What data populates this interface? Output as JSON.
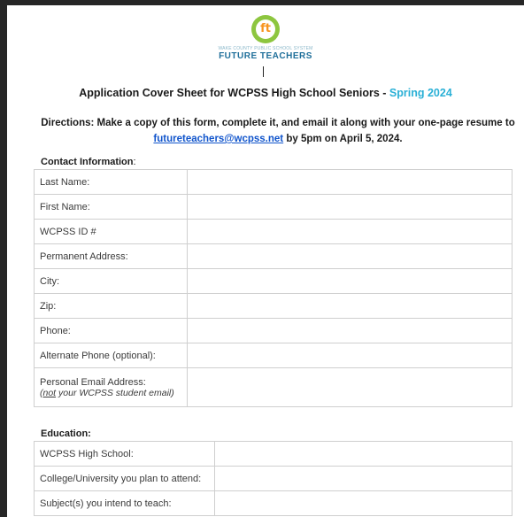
{
  "logo": {
    "mark": "ft",
    "subtitle": "WAKE COUNTY PUBLIC SCHOOL SYSTEM",
    "name": "FUTURE TEACHERS"
  },
  "title": {
    "main": "Application Cover Sheet for WCPSS High School Seniors - ",
    "accent": "Spring 2024"
  },
  "directions": {
    "line1": "Directions: Make a copy of this form, complete it, and email it along with your one-page resume to",
    "email": "futureteachers@wcpss.net",
    "line2_after": " by 5pm on April 5, 2024."
  },
  "contact": {
    "label": "Contact Information",
    "label_suffix": ":",
    "rows": [
      "Last Name:",
      "First Name:",
      "WCPSS ID #",
      "Permanent Address:",
      "City:",
      "Zip:",
      "Phone:",
      "Alternate Phone (optional):",
      "Personal Email Address:"
    ],
    "email_note_not": "not",
    "email_note_rest": " your WCPSS student email)",
    "email_note_open": "("
  },
  "education": {
    "label": "Education:",
    "rows": [
      "WCPSS High School:",
      "College/University you plan to attend:",
      "Subject(s) you intend to teach:"
    ]
  },
  "colors": {
    "accent": "#2ab0d6",
    "link": "#1155cc",
    "logo_green": "#8dc63f",
    "logo_orange": "#f7941d",
    "logo_blue": "#1f6f9a"
  }
}
